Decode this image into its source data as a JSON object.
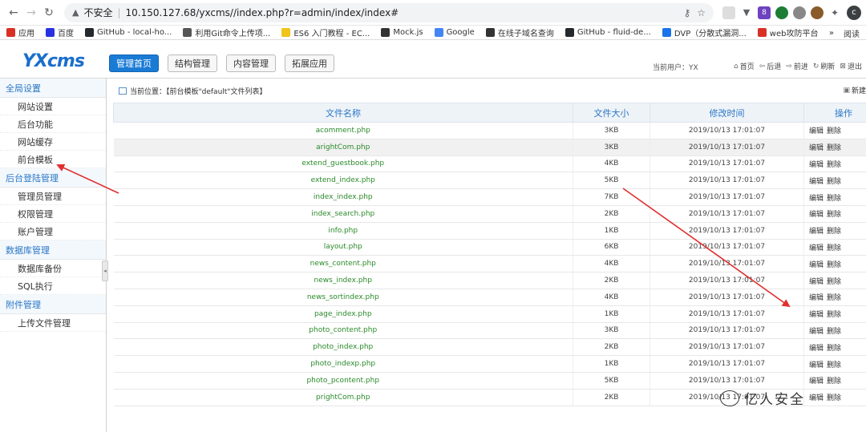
{
  "browser": {
    "warning": "不安全",
    "url": "10.150.127.68/yxcms//index.php?r=admin/index/index#",
    "avatar_letter": "c",
    "bookmarks": [
      {
        "label": "应用",
        "color": "#d93025"
      },
      {
        "label": "百度",
        "color": "#2932e1"
      },
      {
        "label": "GitHub - local-ho...",
        "color": "#24292e"
      },
      {
        "label": "利用Git命令上传项...",
        "color": "#555555"
      },
      {
        "label": "ES6 入门教程 - EC...",
        "color": "#f0c419"
      },
      {
        "label": "Mock.js",
        "color": "#333333"
      },
      {
        "label": "Google",
        "color": "#4285f4"
      },
      {
        "label": "在线子域名查询",
        "color": "#333333"
      },
      {
        "label": "GitHub - fluid-de...",
        "color": "#24292e"
      },
      {
        "label": "DVP（分散式漏洞...",
        "color": "#1a73e8"
      },
      {
        "label": "web攻防平台",
        "color": "#d93025"
      }
    ],
    "more": "»",
    "reading_list": "阅读"
  },
  "header": {
    "logo": "YXcms",
    "tabs": [
      {
        "label": "管理首页",
        "active": true
      },
      {
        "label": "结构管理",
        "active": false
      },
      {
        "label": "内容管理",
        "active": false
      },
      {
        "label": "拓展应用",
        "active": false
      }
    ],
    "user_label": "当前用户：YX",
    "toolbar": [
      {
        "icon": "⌂",
        "label": "首页"
      },
      {
        "icon": "⇦",
        "label": "后退"
      },
      {
        "icon": "⇨",
        "label": "前进"
      },
      {
        "icon": "↻",
        "label": "刷新"
      },
      {
        "icon": "⊠",
        "label": "退出"
      }
    ]
  },
  "sidebar": {
    "groups": [
      {
        "title": "全局设置",
        "items": [
          "网站设置",
          "后台功能",
          "网站缓存",
          "前台模板"
        ]
      },
      {
        "title": "后台登陆管理",
        "items": [
          "管理员管理",
          "权限管理",
          "账户管理"
        ]
      },
      {
        "title": "数据库管理",
        "items": [
          "数据库备份",
          "SQL执行"
        ]
      },
      {
        "title": "附件管理",
        "items": [
          "上传文件管理"
        ]
      }
    ]
  },
  "main": {
    "location": "当前位置：【前台模板\"default\"文件列表】",
    "new_file": "新建",
    "columns": [
      "文件名称",
      "文件大小",
      "修改时间",
      "操作"
    ],
    "ops": [
      "编辑",
      "删除"
    ],
    "rows": [
      {
        "name": "acomment.php",
        "size": "3KB",
        "time": "2019/10/13 17:01:07"
      },
      {
        "name": "arightCom.php",
        "size": "3KB",
        "time": "2019/10/13 17:01:07"
      },
      {
        "name": "extend_guestbook.php",
        "size": "4KB",
        "time": "2019/10/13 17:01:07"
      },
      {
        "name": "extend_index.php",
        "size": "5KB",
        "time": "2019/10/13 17:01:07"
      },
      {
        "name": "index_index.php",
        "size": "7KB",
        "time": "2019/10/13 17:01:07"
      },
      {
        "name": "index_search.php",
        "size": "2KB",
        "time": "2019/10/13 17:01:07"
      },
      {
        "name": "info.php",
        "size": "1KB",
        "time": "2019/10/13 17:01:07"
      },
      {
        "name": "layout.php",
        "size": "6KB",
        "time": "2019/10/13 17:01:07"
      },
      {
        "name": "news_content.php",
        "size": "4KB",
        "time": "2019/10/13 17:01:07"
      },
      {
        "name": "news_index.php",
        "size": "2KB",
        "time": "2019/10/13 17:01:07"
      },
      {
        "name": "news_sortindex.php",
        "size": "4KB",
        "time": "2019/10/13 17:01:07"
      },
      {
        "name": "page_index.php",
        "size": "1KB",
        "time": "2019/10/13 17:01:07"
      },
      {
        "name": "photo_content.php",
        "size": "3KB",
        "time": "2019/10/13 17:01:07"
      },
      {
        "name": "photo_index.php",
        "size": "2KB",
        "time": "2019/10/13 17:01:07"
      },
      {
        "name": "photo_indexp.php",
        "size": "1KB",
        "time": "2019/10/13 17:01:07"
      },
      {
        "name": "photo_pcontent.php",
        "size": "5KB",
        "time": "2019/10/13 17:01:07"
      },
      {
        "name": "prightCom.php",
        "size": "2KB",
        "time": "2019/10/13 17:01:07"
      }
    ]
  },
  "watermark": "亿人安全",
  "colors": {
    "accent": "#1a7bd5",
    "link_green": "#2a8a2a",
    "arrow": "#e03030"
  }
}
